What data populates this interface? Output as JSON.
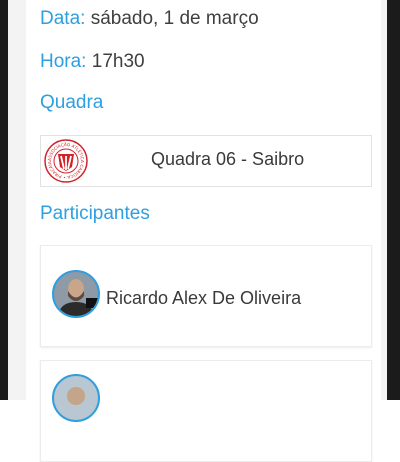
{
  "match": {
    "date_label": "Data:",
    "date_value": "sábado, 1 de março",
    "time_label": "Hora:",
    "time_value": "17h30"
  },
  "court": {
    "section_title": "Quadra",
    "name": "Quadra 06 - Saibro",
    "logo_text": "ASSOCIAÇÃO ATLÉTICA CARIOCA • PIRACAIA",
    "accent_color": "#d2232a"
  },
  "participants": {
    "section_title": "Participantes",
    "items": [
      {
        "name": "Ricardo Alex De Oliveira"
      },
      {
        "name": ""
      }
    ]
  },
  "theme": {
    "accent": "#2e9fe0",
    "text": "#3a3a3a",
    "background": "#f3f3f3"
  }
}
